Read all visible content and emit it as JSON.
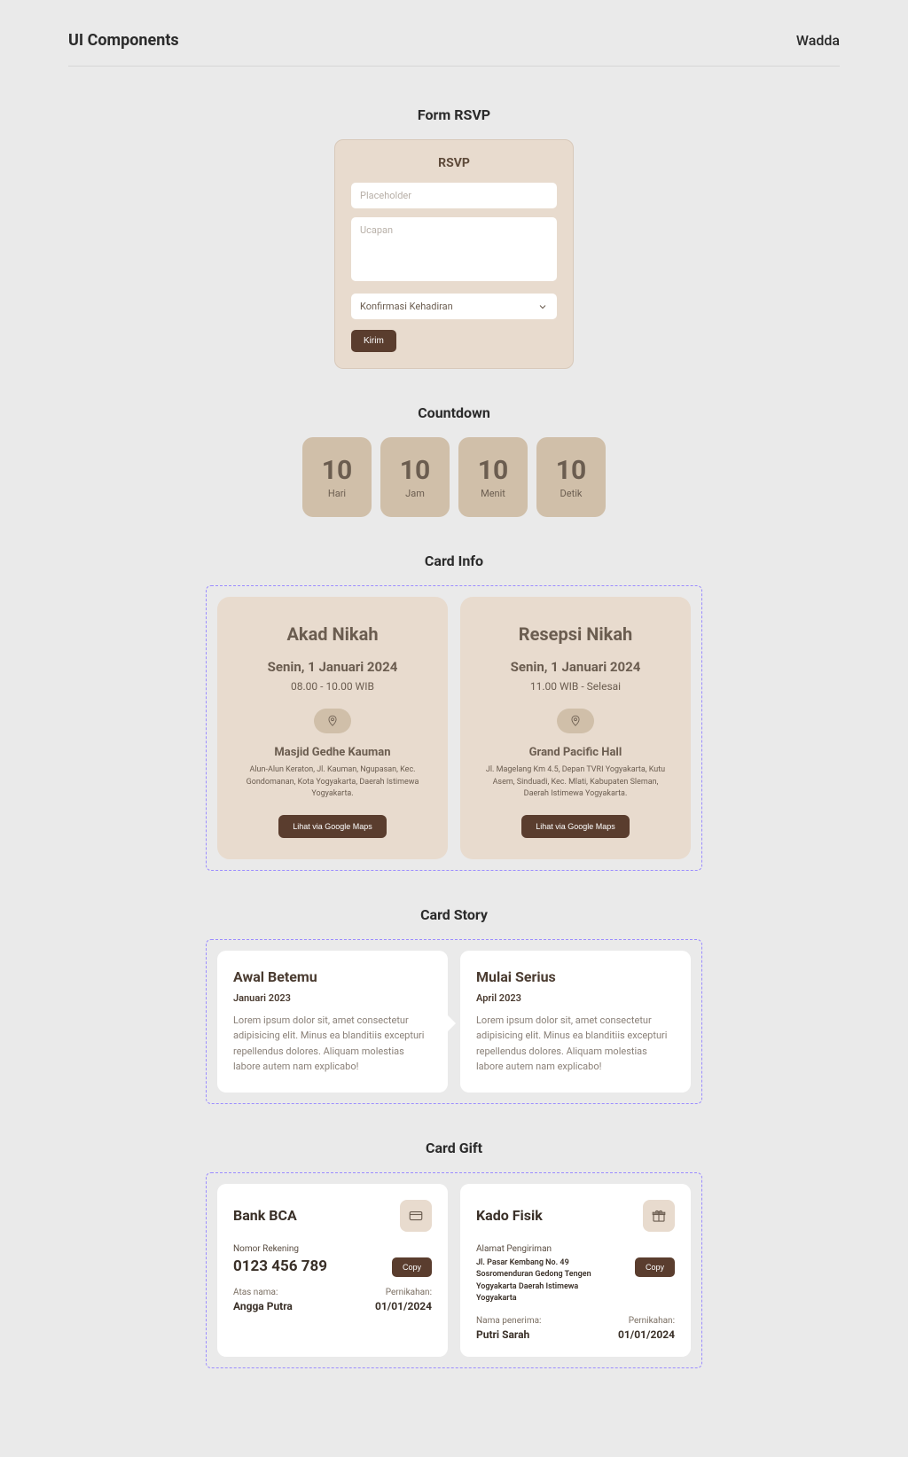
{
  "header": {
    "title": "UI Components",
    "brand": "Wadda"
  },
  "sections": {
    "rsvp": "Form RSVP",
    "countdown": "Countdown",
    "cardInfo": "Card Info",
    "cardStory": "Card Story",
    "cardGift": "Card Gift"
  },
  "rsvp": {
    "title": "RSVP",
    "namePlaceholder": "Placeholder",
    "msgPlaceholder": "Ucapan",
    "selectLabel": "Konfirmasi Kehadiran",
    "submit": "Kirim"
  },
  "countdown": [
    {
      "value": "10",
      "label": "Hari"
    },
    {
      "value": "10",
      "label": "Jam"
    },
    {
      "value": "10",
      "label": "Menit"
    },
    {
      "value": "10",
      "label": "Detik"
    }
  ],
  "info": [
    {
      "title": "Akad Nikah",
      "date": "Senin, 1 Januari 2024",
      "time": "08.00 - 10.00 WIB",
      "venue": "Masjid Gedhe Kauman",
      "addr": "Alun-Alun Keraton, Jl. Kauman, Ngupasan, Kec. Gondomanan, Kota Yogyakarta, Daerah Istimewa Yogyakarta.",
      "btn": "Lihat via Google Maps"
    },
    {
      "title": "Resepsi Nikah",
      "date": "Senin, 1 Januari 2024",
      "time": "11.00 WIB - Selesai",
      "venue": "Grand Pacific Hall",
      "addr": "Jl. Magelang Km 4.5, Depan TVRI Yogyakarta, Kutu Asem, Sinduadi, Kec. Mlati, Kabupaten Sleman, Daerah Istimewa Yogyakarta.",
      "btn": "Lihat via Google Maps"
    }
  ],
  "story": [
    {
      "title": "Awal Betemu",
      "date": "Januari 2023",
      "body": "Lorem ipsum dolor sit, amet consectetur adipisicing elit. Minus ea blanditiis excepturi repellendus dolores. Aliquam molestias labore autem nam explicabo!"
    },
    {
      "title": "Mulai Serius",
      "date": "April 2023",
      "body": "Lorem ipsum dolor sit, amet consectetur adipisicing elit. Minus ea blanditiis excepturi repellendus dolores. Aliquam molestias labore autem nam explicabo!"
    }
  ],
  "gift": [
    {
      "title": "Bank BCA",
      "icon": "card",
      "label": "Nomor Rekening",
      "value": "0123 456 789",
      "copy": "Copy",
      "ownerLabel": "Atas nama:",
      "owner": "Angga Putra",
      "dateLabel": "Pernikahan:",
      "date": "01/01/2024"
    },
    {
      "title": "Kado Fisik",
      "icon": "gift",
      "label": "Alamat Pengiriman",
      "value": "Jl. Pasar Kembang No. 49 Sosromenduran Gedong Tengen Yogyakarta Daerah Istimewa Yogyakarta",
      "copy": "Copy",
      "ownerLabel": "Nama penerima:",
      "owner": "Putri Sarah",
      "dateLabel": "Pernikahan:",
      "date": "01/01/2024"
    }
  ]
}
